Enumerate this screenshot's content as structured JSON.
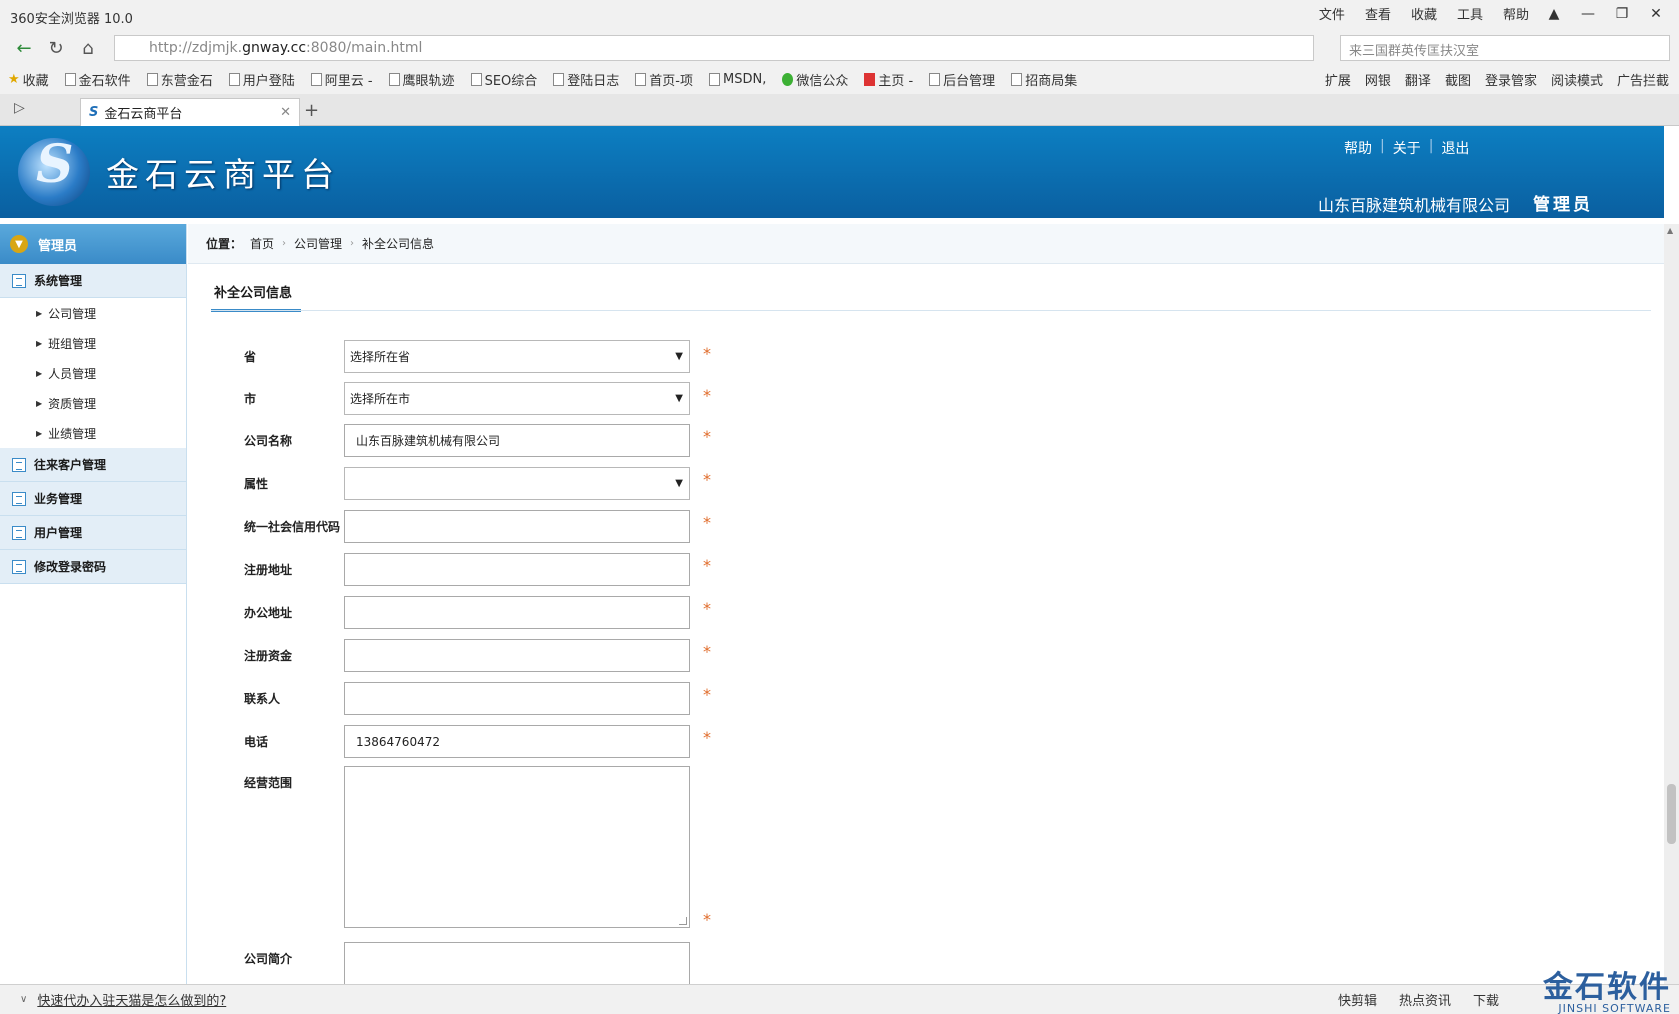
{
  "browser": {
    "app_title": "360安全浏览器 10.0",
    "menu": [
      "文件",
      "查看",
      "收藏",
      "工具",
      "帮助"
    ],
    "url_prefix": "http://zdjmjk.",
    "url_domain": "gnway.cc",
    "url_suffix": ":8080/main.html",
    "search_placeholder": "来三国群英传匡扶汉室",
    "bookmarks": [
      "收藏",
      "金石软件",
      "东营金石",
      "用户登陆",
      "阿里云 -",
      "鹰眼轨迹",
      "SEO综合",
      "登陆日志",
      "首页-项",
      "MSDN,",
      "微信公众",
      "主页 -",
      "后台管理",
      "招商局集"
    ],
    "tools": [
      "扩展",
      "网银",
      "翻译",
      "截图",
      "登录管家",
      "阅读模式",
      "广告拦截"
    ],
    "tab_title": "金石云商平台"
  },
  "header": {
    "title": "金石云商平台",
    "links": [
      "帮助",
      "关于",
      "退出"
    ],
    "company": "山东百脉建筑机械有限公司",
    "role": "管理员"
  },
  "sidebar": {
    "role": "管理员",
    "system_group": "系统管理",
    "sub_items": [
      "公司管理",
      "班组管理",
      "人员管理",
      "资质管理",
      "业绩管理"
    ],
    "groups": [
      "往来客户管理",
      "业务管理",
      "用户管理",
      "修改登录密码"
    ]
  },
  "breadcrumb": {
    "label": "位置：",
    "items": [
      "首页",
      "公司管理",
      "补全公司信息"
    ]
  },
  "form": {
    "title": "补全公司信息",
    "fields": [
      {
        "label": "省",
        "value": "选择所在省"
      },
      {
        "label": "市",
        "value": "选择所在市"
      },
      {
        "label": "公司名称",
        "value": "山东百脉建筑机械有限公司"
      },
      {
        "label": "属性",
        "value": ""
      },
      {
        "label": "统一社会信用代码",
        "value": ""
      },
      {
        "label": "注册地址",
        "value": ""
      },
      {
        "label": "办公地址",
        "value": ""
      },
      {
        "label": "注册资金",
        "value": ""
      },
      {
        "label": "联系人",
        "value": ""
      },
      {
        "label": "电话",
        "value": "13864760472"
      },
      {
        "label": "经营范围",
        "value": ""
      },
      {
        "label": "公司简介",
        "value": ""
      }
    ],
    "required_mark": "*"
  },
  "statusbar": {
    "news": "快速代办入驻天猫是怎么做到的?",
    "items": [
      "快剪辑",
      "热点资讯",
      "下载"
    ]
  },
  "watermark": {
    "cn": "金石软件",
    "en": "JINSHI SOFTWARE"
  }
}
